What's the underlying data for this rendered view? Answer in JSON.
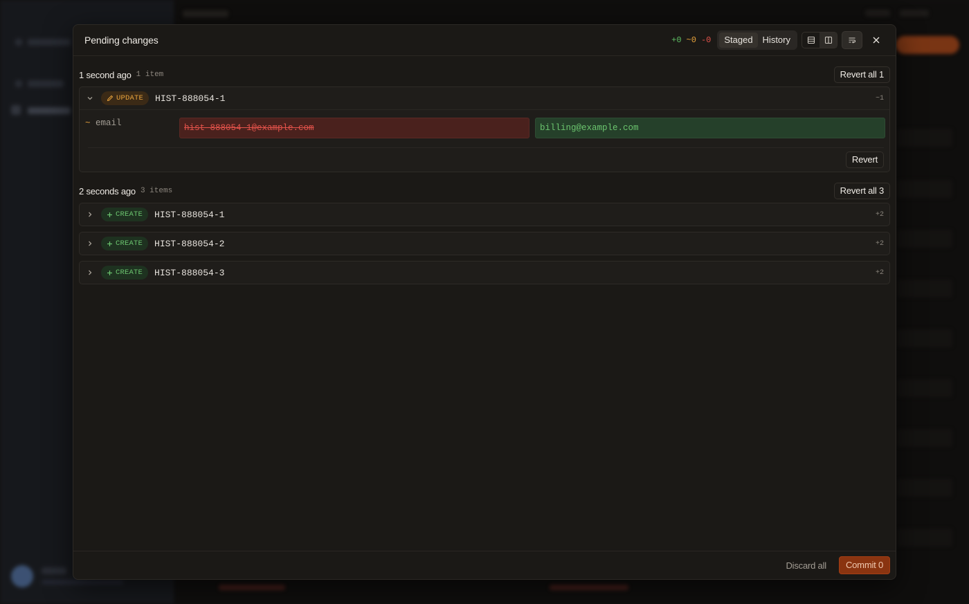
{
  "modal": {
    "title": "Pending changes",
    "counts": {
      "added": "+0",
      "modified": "~0",
      "deleted": "-0"
    },
    "tabs": [
      {
        "label": "Staged",
        "active": true
      },
      {
        "label": "History",
        "active": false
      }
    ],
    "view_icons": [
      "rows-icon",
      "split-view-icon",
      "wrap-text-icon"
    ],
    "close_icon": "close-icon"
  },
  "groups": [
    {
      "time": "1 second ago",
      "count": "1 item",
      "revert_all_label": "Revert all 1",
      "items": [
        {
          "expanded": true,
          "op": "UPDATE",
          "record_id": "HIST-888054-1",
          "delta": "~1",
          "field": {
            "marker": "~",
            "name": "email",
            "old": "hist-888054-1@example.com",
            "new": "billing@example.com"
          },
          "revert_label": "Revert"
        }
      ]
    },
    {
      "time": "2 seconds ago",
      "count": "3 items",
      "revert_all_label": "Revert all 3",
      "items": [
        {
          "expanded": false,
          "op": "CREATE",
          "record_id": "HIST-888054-1",
          "delta": "+2"
        },
        {
          "expanded": false,
          "op": "CREATE",
          "record_id": "HIST-888054-2",
          "delta": "+2"
        },
        {
          "expanded": false,
          "op": "CREATE",
          "record_id": "HIST-888054-3",
          "delta": "+2"
        }
      ]
    }
  ],
  "footer": {
    "discard_label": "Discard all",
    "commit_label": "Commit 0"
  },
  "colors": {
    "accent": "#d2561c",
    "added": "#5fbf64",
    "modified": "#e8a33c",
    "deleted": "#e5534b"
  }
}
